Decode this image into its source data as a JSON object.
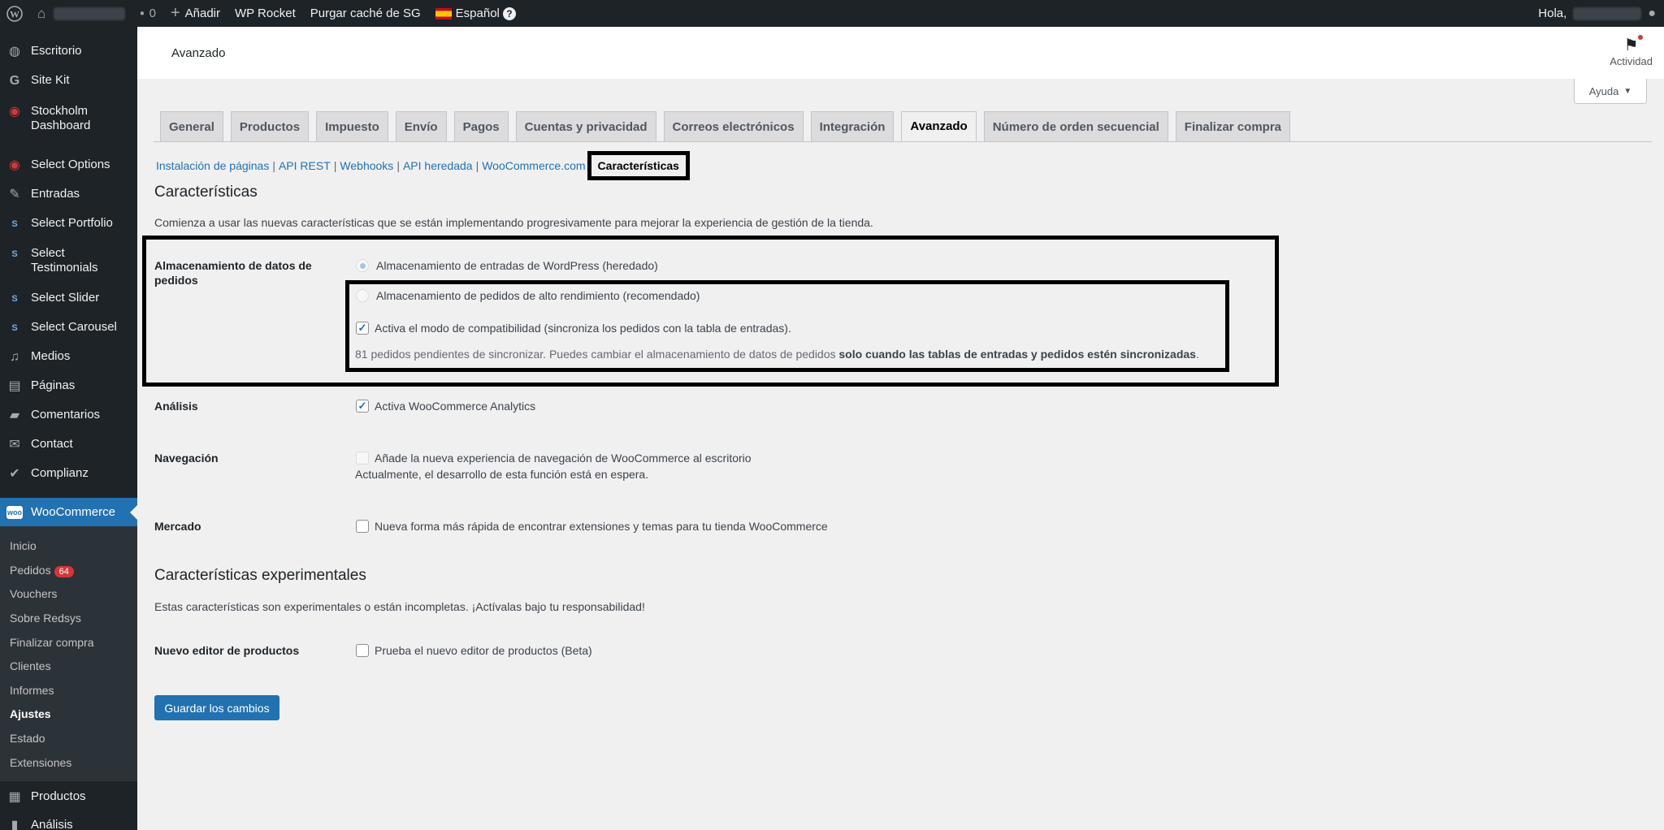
{
  "adminbar": {
    "comments_count": "0",
    "add_new": "Añadir",
    "wp_rocket": "WP Rocket",
    "purge_cache": "Purgar caché de SG",
    "language": "Español",
    "greeting": "Hola,"
  },
  "sidebar": {
    "items": [
      {
        "label": "Escritorio",
        "icon": "dashboard-icon"
      },
      {
        "label": "Site Kit",
        "icon": "google-g-icon"
      },
      {
        "label": "Stockholm Dashboard",
        "icon": "stockholm-icon"
      },
      {
        "label": "Select Options",
        "icon": "stockholm-icon"
      },
      {
        "label": "Entradas",
        "icon": "pin-icon"
      },
      {
        "label": "Select Portfolio",
        "icon": "select-s-icon"
      },
      {
        "label": "Select Testimonials",
        "icon": "select-s-icon"
      },
      {
        "label": "Select Slider",
        "icon": "select-s-icon"
      },
      {
        "label": "Select Carousel",
        "icon": "select-s-icon"
      },
      {
        "label": "Medios",
        "icon": "media-icon"
      },
      {
        "label": "Páginas",
        "icon": "pages-icon"
      },
      {
        "label": "Comentarios",
        "icon": "comments-icon"
      },
      {
        "label": "Contact",
        "icon": "mail-icon"
      },
      {
        "label": "Complianz",
        "icon": "check-icon"
      },
      {
        "label": "WooCommerce",
        "icon": "woo-icon"
      },
      {
        "label": "Productos",
        "icon": "products-icon"
      },
      {
        "label": "Análisis",
        "icon": "analytics-icon"
      }
    ],
    "woo_submenu": [
      "Inicio",
      "Pedidos",
      "Vouchers",
      "Sobre Redsys",
      "Finalizar compra",
      "Clientes",
      "Informes",
      "Ajustes",
      "Estado",
      "Extensiones"
    ],
    "orders_badge": "64"
  },
  "header": {
    "title": "Avanzado",
    "activity": "Actividad",
    "help": "Ayuda"
  },
  "tabs": [
    "General",
    "Productos",
    "Impuesto",
    "Envío",
    "Pagos",
    "Cuentas y privacidad",
    "Correos electrónicos",
    "Integración",
    "Avanzado",
    "Número de orden secuencial",
    "Finalizar compra"
  ],
  "active_tab": "Avanzado",
  "subsections": [
    "Instalación de páginas",
    "API REST",
    "Webhooks",
    "API heredada",
    "WooCommerce.com",
    "Características"
  ],
  "content": {
    "features_title": "Características",
    "features_desc": "Comienza a usar las nuevas características que se están implementando progresivamente para mejorar la experiencia de gestión de la tienda.",
    "order_storage_label": "Almacenamiento de datos de pedidos",
    "opt_wp_posts": "Almacenamiento de entradas de WordPress (heredado)",
    "opt_hpos": "Almacenamiento de pedidos de alto rendimiento (recomendado)",
    "compat_mode": "Activa el modo de compatibilidad (sincroniza los pedidos con la tabla de entradas).",
    "sync_note_a": "81 pedidos pendientes de sincronizar. Puedes cambiar el almacenamiento de datos de pedidos ",
    "sync_note_b": "solo cuando las tablas de entradas y pedidos estén sincronizadas",
    "sync_note_c": ".",
    "analytics_label": "Análisis",
    "analytics_opt": "Activa WooCommerce Analytics",
    "navigation_label": "Navegación",
    "navigation_opt": "Añade la nueva experiencia de navegación de WooCommerce al escritorio",
    "navigation_note": "Actualmente, el desarrollo de esta función está en espera.",
    "market_label": "Mercado",
    "market_opt": "Nueva forma más rápida de encontrar extensiones y temas para tu tienda WooCommerce",
    "experimental_title": "Características experimentales",
    "experimental_desc": "Estas características son experimentales o están incompletas. ¡Actívalas bajo tu responsabilidad!",
    "product_editor_label": "Nuevo editor de productos",
    "product_editor_opt": "Prueba el nuevo editor de productos (Beta)",
    "save": "Guardar los cambios"
  },
  "colors": {
    "accent": "#2271b1",
    "sidebar": "#1d2327",
    "badge": "#d63638"
  }
}
